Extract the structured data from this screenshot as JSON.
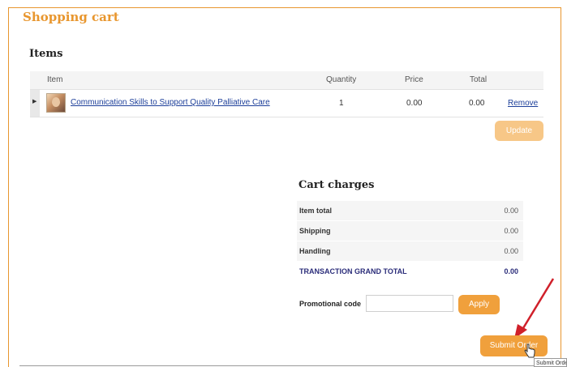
{
  "page": {
    "title": "Shopping cart"
  },
  "items": {
    "heading": "Items",
    "columns": {
      "item": "Item",
      "quantity": "Quantity",
      "price": "Price",
      "total": "Total"
    },
    "rows": [
      {
        "name": "Communication Skills to Support Quality Palliative Care",
        "quantity": "1",
        "price": "0.00",
        "total": "0.00",
        "remove_label": "Remove"
      }
    ],
    "update_label": "Update"
  },
  "charges": {
    "heading": "Cart charges",
    "rows": [
      {
        "label": "Item total",
        "value": "0.00"
      },
      {
        "label": "Shipping",
        "value": "0.00"
      },
      {
        "label": "Handling",
        "value": "0.00"
      },
      {
        "label": "TRANSACTION GRAND TOTAL",
        "value": "0.00"
      }
    ]
  },
  "promo": {
    "label": "Promotional code",
    "value": "",
    "apply_label": "Apply"
  },
  "submit": {
    "label": "Submit Order",
    "tooltip": "Submit Order"
  },
  "colors": {
    "accent": "#f0a03c",
    "title": "#e8962e",
    "grand_total": "#2b2d7a",
    "annotation_arrow": "#d0202a"
  }
}
